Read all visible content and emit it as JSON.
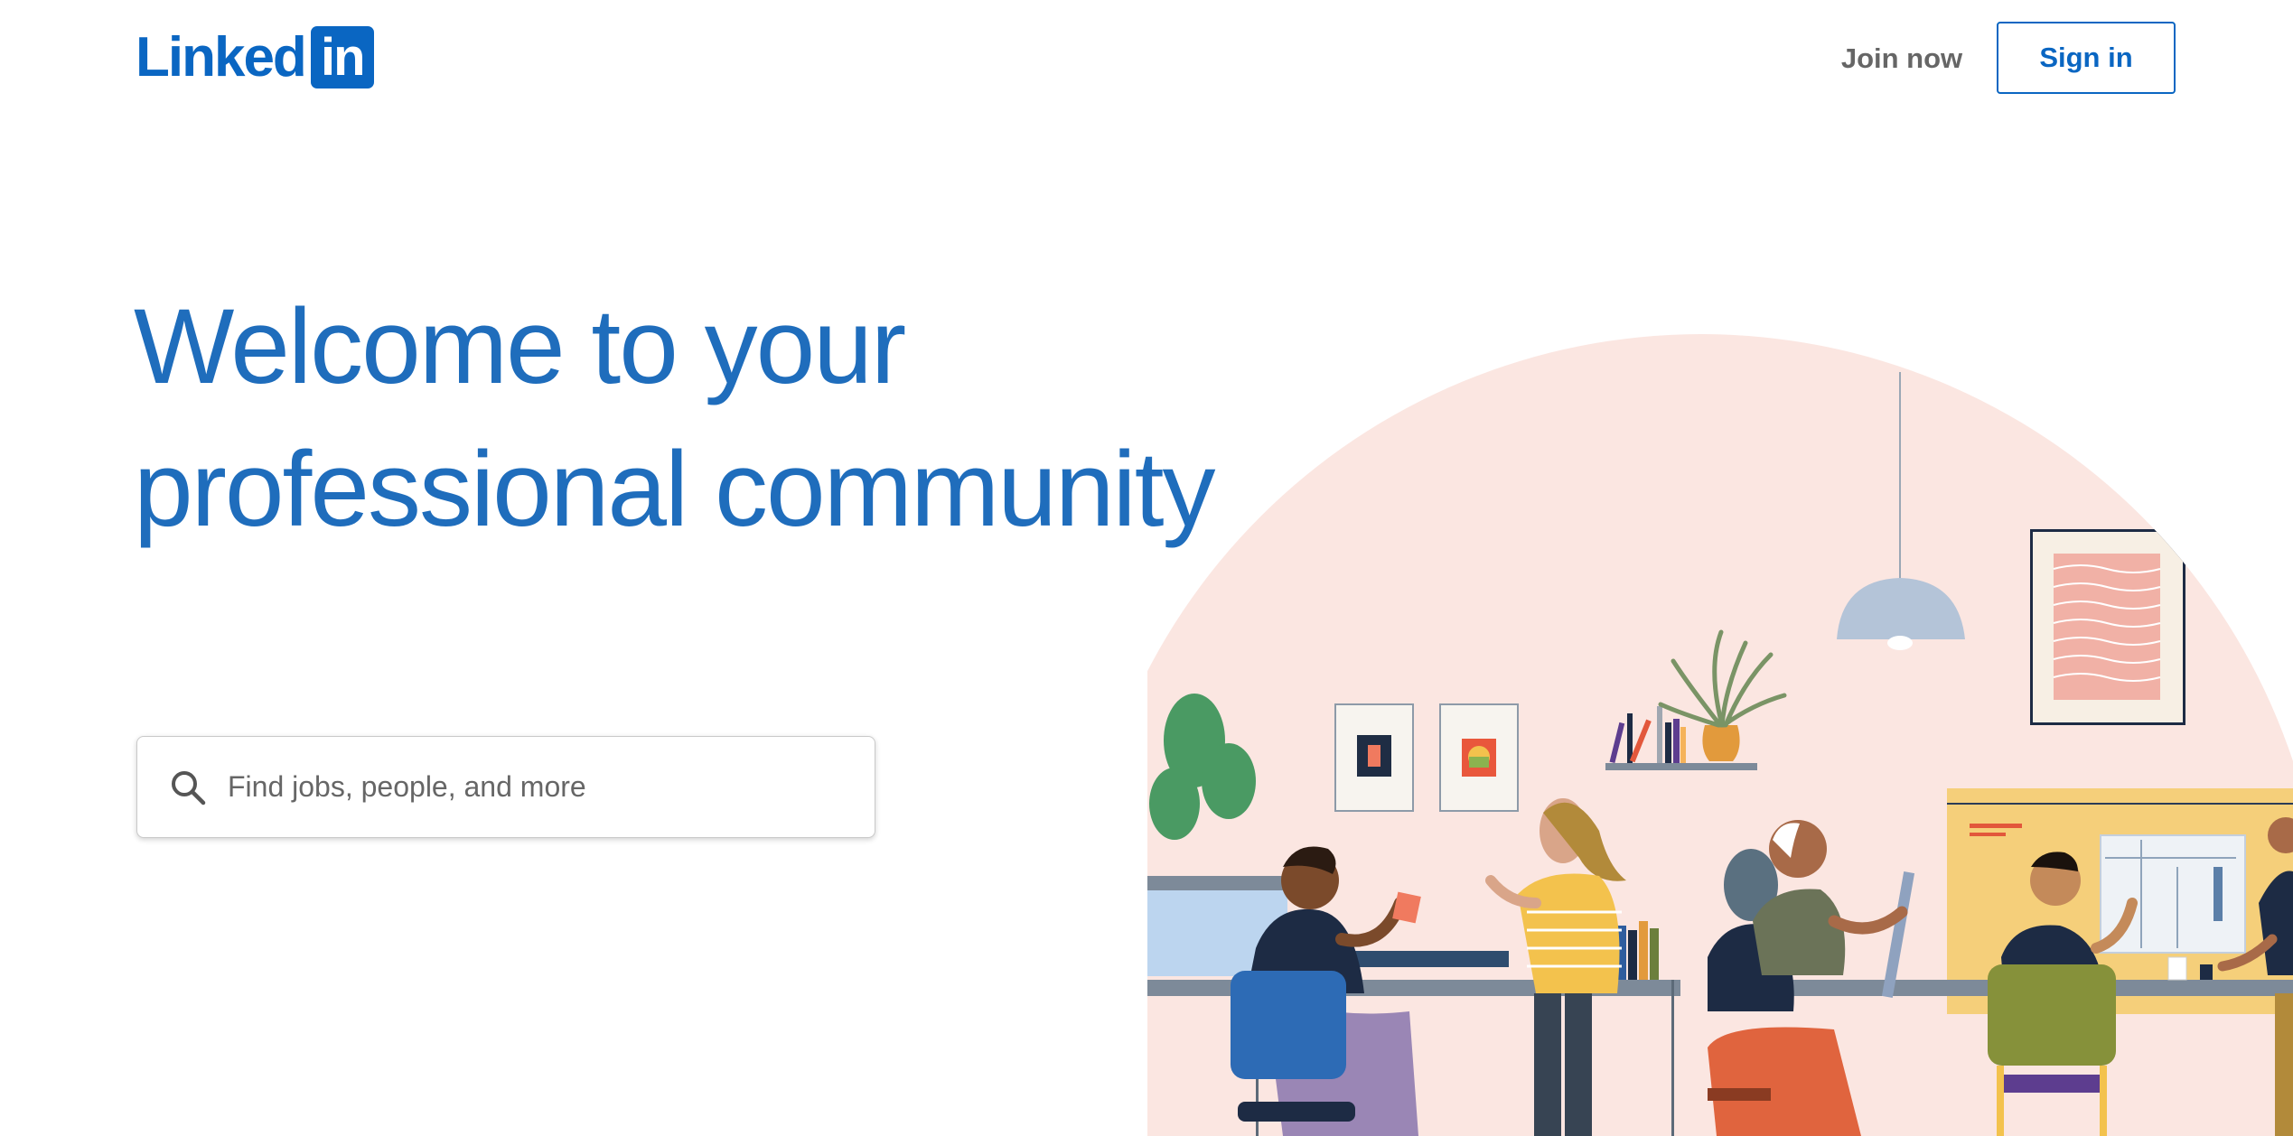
{
  "header": {
    "logo_text": "Linked",
    "logo_badge_text": "in",
    "join_now_label": "Join now",
    "sign_in_label": "Sign in"
  },
  "hero": {
    "title_line1": "Welcome to your",
    "title_line2": "professional community"
  },
  "search": {
    "placeholder": "Find jobs, people, and more",
    "value": "",
    "icon": "search-icon"
  },
  "illustration": {
    "icon": "office-illustration"
  },
  "colors": {
    "brand": "#0a66c2",
    "heading": "#1f6dbc",
    "muted_text": "#666666",
    "illustration_bg": "#fbe6e1"
  }
}
